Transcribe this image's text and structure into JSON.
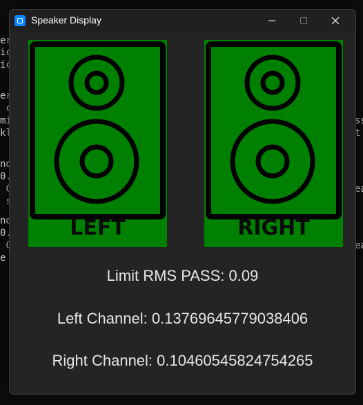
{
  "background_console": {
    "lines": [
      "er",
      "ic",
      "ic",
      "",
      "er",
      " c",
      "mi",
      "kl",
      "",
      "nd",
      "0.",
      " C",
      " s",
      "nd",
      "0.",
      " C",
      "e s"
    ],
    "right_lines": [
      "ss",
      "t",
      "",
      "ea",
      "",
      "ea"
    ]
  },
  "window": {
    "title": "Speaker Display",
    "icon": "app-window-icon",
    "controls": {
      "minimize": "minimize-icon",
      "maximize": "maximize-icon",
      "close": "close-icon"
    }
  },
  "speakers": {
    "left": {
      "label": "LEFT",
      "fill": "#008000"
    },
    "right": {
      "label": "RIGHT",
      "fill": "#008000"
    }
  },
  "info": {
    "limit": "Limit RMS PASS: 0.09",
    "left_channel": "Left Channel: 0.13769645779038406",
    "right_channel": "Right Channel: 0.10460545824754265"
  },
  "colors": {
    "window_bg": "#242424",
    "speaker_green": "#008000",
    "text": "#e6e6e6"
  }
}
